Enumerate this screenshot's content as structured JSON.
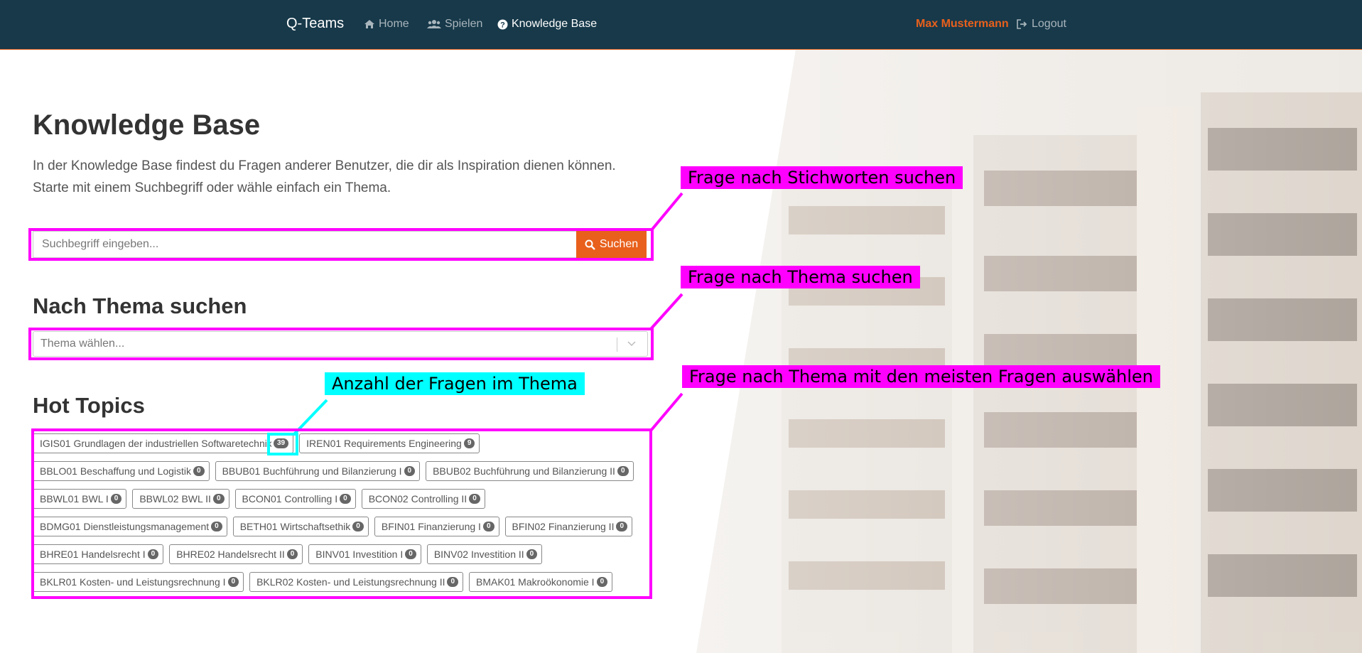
{
  "nav": {
    "brand": "Q-Teams",
    "home": "Home",
    "play": "Spielen",
    "kb": "Knowledge Base",
    "user": "Max Mustermann",
    "logout": "Logout"
  },
  "page": {
    "title": "Knowledge Base",
    "intro": "In der Knowledge Base findest du Fragen anderer Benutzer, die dir als Inspiration dienen können. Starte mit einem Suchbegriff oder wähle einfach ein Thema.",
    "search_placeholder": "Suchbegriff eingeben...",
    "search_button": "Suchen",
    "topic_heading": "Nach Thema suchen",
    "topic_placeholder": "Thema wählen...",
    "hot_heading": "Hot Topics"
  },
  "hot_topics": [
    [
      {
        "label": "IGIS01 Grundlagen der industriellen Softwaretechnik",
        "count": "39"
      },
      {
        "label": "IREN01 Requirements Engineering",
        "count": "9"
      }
    ],
    [
      {
        "label": "BBLO01 Beschaffung und Logistik",
        "count": "0"
      },
      {
        "label": "BBUB01 Buchführung und Bilanzierung I",
        "count": "0"
      },
      {
        "label": "BBUB02 Buchführung und Bilanzierung II",
        "count": "0"
      }
    ],
    [
      {
        "label": "BBWL01 BWL I",
        "count": "0"
      },
      {
        "label": "BBWL02 BWL II",
        "count": "0"
      },
      {
        "label": "BCON01 Controlling I",
        "count": "0"
      },
      {
        "label": "BCON02 Controlling II",
        "count": "0"
      }
    ],
    [
      {
        "label": "BDMG01 Dienstleistungsmanagement",
        "count": "0"
      },
      {
        "label": "BETH01 Wirtschaftsethik",
        "count": "0"
      },
      {
        "label": "BFIN01 Finanzierung I",
        "count": "0"
      },
      {
        "label": "BFIN02 Finanzierung II",
        "count": "0"
      }
    ],
    [
      {
        "label": "BHRE01 Handelsrecht I",
        "count": "0"
      },
      {
        "label": "BHRE02 Handelsrecht II",
        "count": "0"
      },
      {
        "label": "BINV01 Investition I",
        "count": "0"
      },
      {
        "label": "BINV02 Investition II",
        "count": "0"
      }
    ],
    [
      {
        "label": "BKLR01 Kosten- und Leistungsrechnung I",
        "count": "0"
      },
      {
        "label": "BKLR02 Kosten- und Leistungsrechnung II",
        "count": "0"
      },
      {
        "label": "BMAK01 Makroökonomie I",
        "count": "0"
      }
    ]
  ],
  "annotations": {
    "search": "Frage nach Stichworten suchen",
    "topic": "Frage nach Thema suchen",
    "count": "Anzahl der Fragen im Thema",
    "hot": "Frage nach Thema mit den meisten Fragen auswählen"
  },
  "colors": {
    "navbar": "#17394a",
    "accent": "#e8601c",
    "annotation_magenta": "#ff00ff",
    "annotation_cyan": "#00ffff"
  }
}
